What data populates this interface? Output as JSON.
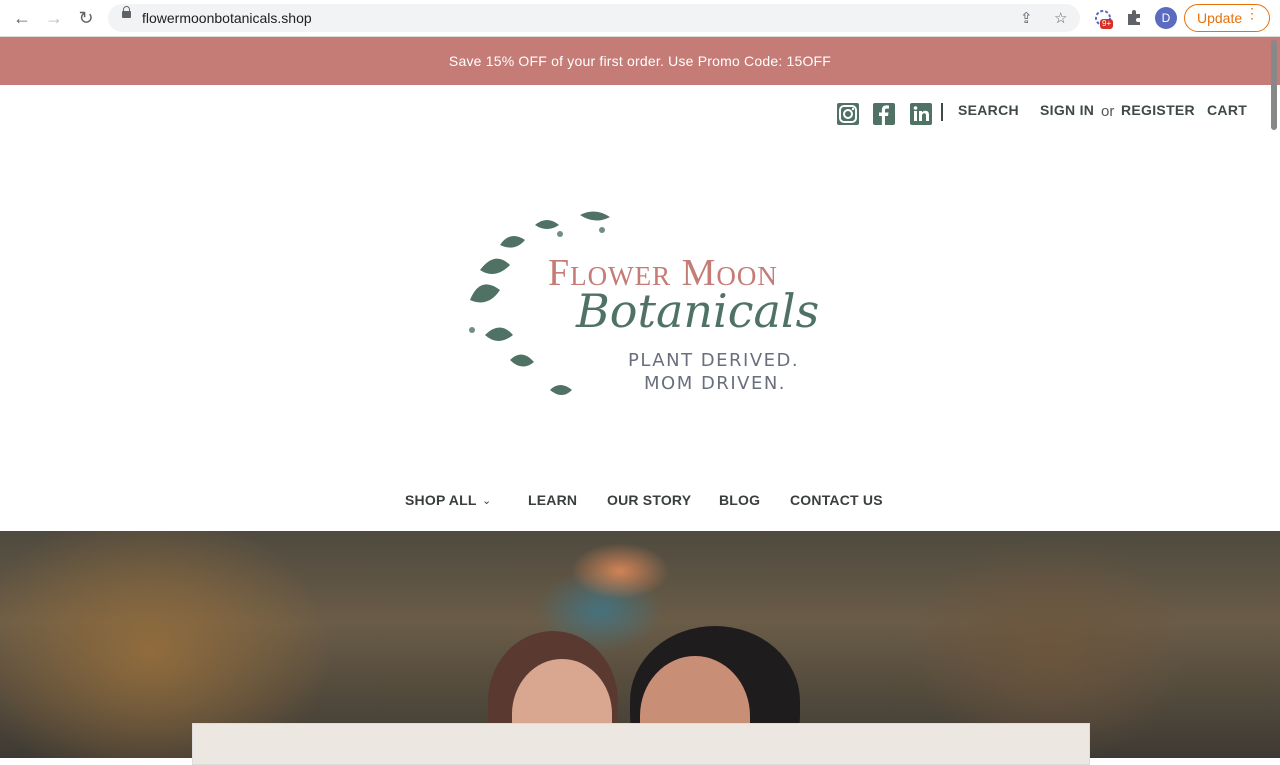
{
  "browser": {
    "url": "flowermoonbotanicals.shop",
    "profile_initial": "D",
    "extension_badge": "9+",
    "update_label": "Update"
  },
  "promo": {
    "text": "Save 15% OFF of your first order. Use Promo Code: 15OFF"
  },
  "utility_nav": {
    "search": "SEARCH",
    "sign_in": "SIGN IN",
    "or": "or",
    "register": "REGISTER",
    "cart": "CART",
    "social": [
      "instagram-icon",
      "facebook-icon",
      "linkedin-icon"
    ]
  },
  "logo": {
    "title": "Flower Moon",
    "script": "Botanicals",
    "tagline_1": "PLANT DERIVED.",
    "tagline_2": "MOM DRIVEN."
  },
  "main_nav": {
    "items": [
      "SHOP ALL",
      "LEARN",
      "OUR STORY",
      "BLOG",
      "CONTACT US"
    ]
  },
  "colors": {
    "promo_bg": "#c57b76",
    "brand_green": "#4f7265",
    "brand_rose": "#c57b76"
  }
}
